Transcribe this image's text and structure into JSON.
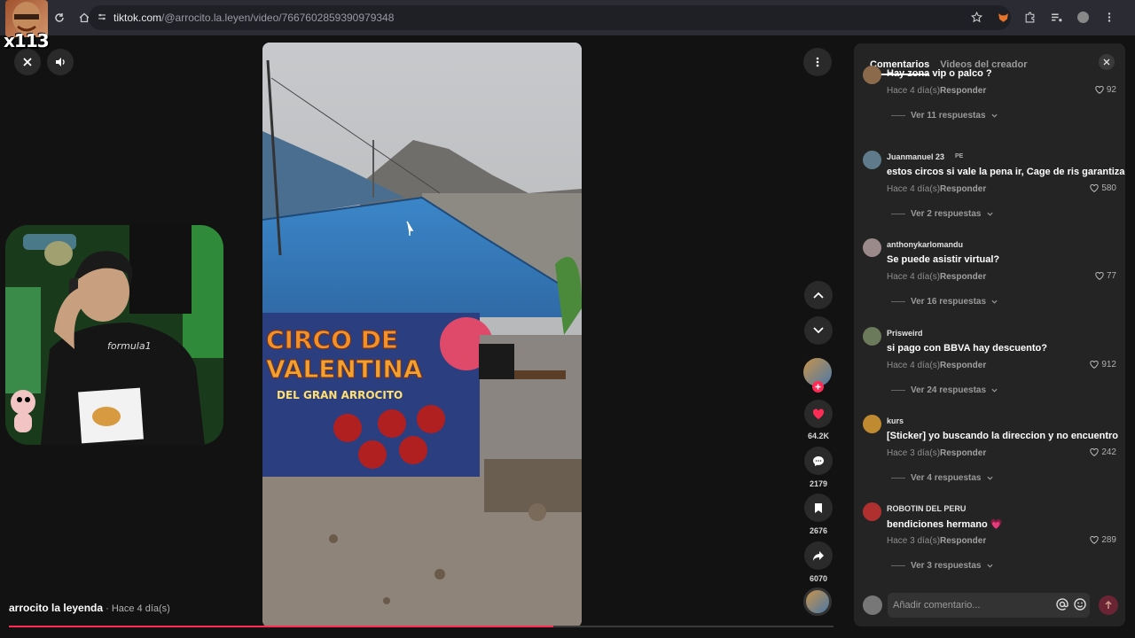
{
  "browser": {
    "url_host": "tiktok.com",
    "url_path": "/@arrocito.la.leyen/video/7667602859390979348"
  },
  "overlay": {
    "counter": "x113"
  },
  "video": {
    "banner_line1": "CIRCO DE",
    "banner_line2": "VALENTINA",
    "banner_line3": "DEL GRAN ARROCITO"
  },
  "rail": {
    "likes": "64.2K",
    "comments": "2179",
    "saves": "2676",
    "shares": "6070"
  },
  "caption": {
    "author": "arrocito la leyenda",
    "when": " · Hace 4 día(s)",
    "progress": 0.66
  },
  "webcam": {
    "shirt_text": "formula1"
  },
  "panel": {
    "tab_comments": "Comentarios",
    "tab_creator": "Videos del creador",
    "comments": [
      {
        "user": "",
        "text": "Hay zona vip o palco ?",
        "meta": "Hace 4 día(s)",
        "reply": "Responder",
        "likes": "92",
        "replies": "Ver 11 respuestas",
        "avatar_color": "#8a6a4a"
      },
      {
        "user": "Juanmanuel 23",
        "flag": "PE",
        "text": "estos circos si vale la pena ir, Cage de ris garantizado,",
        "meta": "Hace 4 día(s)",
        "reply": "Responder",
        "likes": "580",
        "replies": "Ver 2 respuestas",
        "avatar_color": "#5f7a8a"
      },
      {
        "user": "anthonykarlomandu",
        "text": "Se puede asistir virtual?",
        "meta": "Hace 4 día(s)",
        "reply": "Responder",
        "likes": "77",
        "replies": "Ver 16 respuestas",
        "avatar_color": "#9a8a8a"
      },
      {
        "user": "Prisweird",
        "text": "si pago con BBVA hay descuento?",
        "meta": "Hace 4 día(s)",
        "reply": "Responder",
        "likes": "912",
        "replies": "Ver 24 respuestas",
        "avatar_color": "#6a7a5a"
      },
      {
        "user": "kurs",
        "text": "[Sticker] yo buscando la direccion y no encuentro",
        "meta": "Hace 3 día(s)",
        "reply": "Responder",
        "likes": "242",
        "replies": "Ver 4 respuestas",
        "avatar_color": "#c08a30"
      },
      {
        "user": "ROBOTIN DEL PERU",
        "text": "bendiciones hermano 💗",
        "meta": "Hace 3 día(s)",
        "reply": "Responder",
        "likes": "289",
        "replies": "Ver 3 respuestas",
        "avatar_color": "#b03030"
      }
    ],
    "input_placeholder": "Añadir comentario..."
  },
  "colors": {
    "accent": "#fe2c55",
    "panel_bg": "#242424",
    "page_bg": "#121212"
  }
}
